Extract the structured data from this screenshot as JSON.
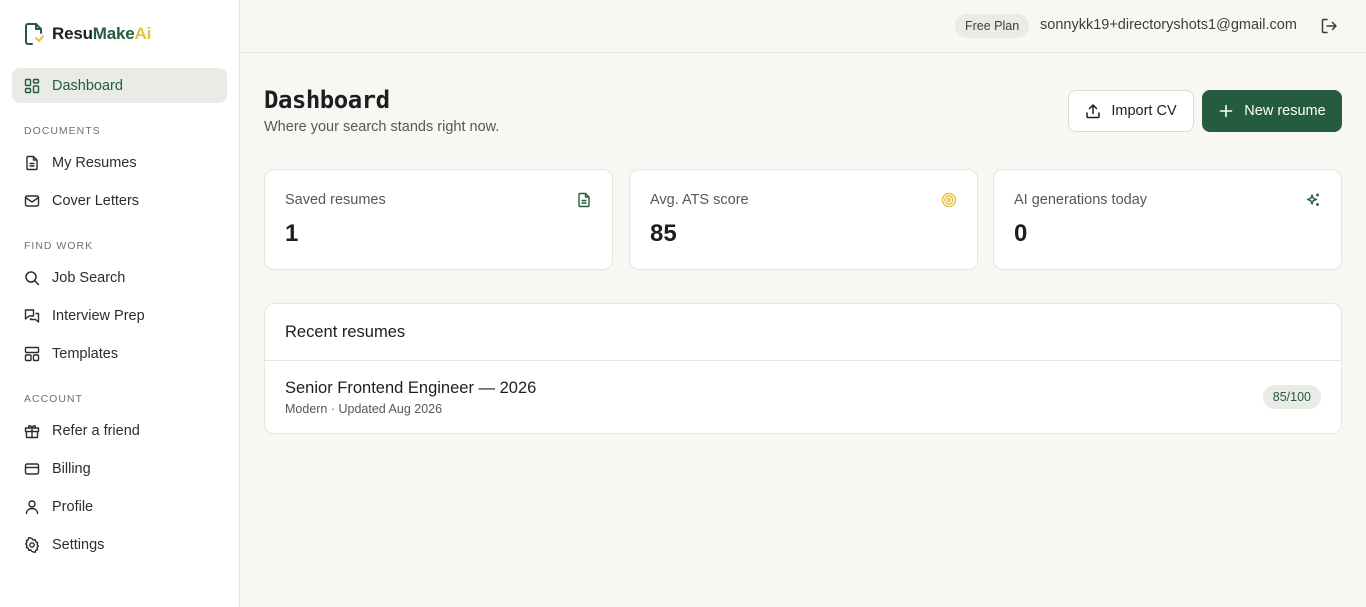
{
  "brand": {
    "part1": "Resu",
    "part2": "Make",
    "part3": "Ai"
  },
  "sidebar": {
    "dashboard": "Dashboard",
    "sections": {
      "documents": "DOCUMENTS",
      "find_work": "FIND WORK",
      "account": "ACCOUNT"
    },
    "items": {
      "my_resumes": "My Resumes",
      "cover_letters": "Cover Letters",
      "job_search": "Job Search",
      "interview_prep": "Interview Prep",
      "templates": "Templates",
      "refer": "Refer a friend",
      "billing": "Billing",
      "profile": "Profile",
      "settings": "Settings"
    }
  },
  "header": {
    "plan": "Free Plan",
    "email": "sonnykk19+directoryshots1@gmail.com"
  },
  "main": {
    "title": "Dashboard",
    "subtitle": "Where your search stands right now.",
    "import_label": "Import CV",
    "new_label": "New resume",
    "stats": [
      {
        "label": "Saved resumes",
        "value": "1",
        "icon": "document-icon"
      },
      {
        "label": "Avg. ATS score",
        "value": "85",
        "icon": "target-icon"
      },
      {
        "label": "AI generations today",
        "value": "0",
        "icon": "sparkles-icon"
      }
    ],
    "recent": {
      "title": "Recent resumes",
      "items": [
        {
          "title": "Senior Frontend Engineer — 2026",
          "meta": "Modern · Updated Aug 2026",
          "score": "85/100"
        }
      ]
    }
  },
  "colors": {
    "accent": "#255c3f",
    "brand_yellow": "#e7c33b",
    "background": "#f8f7f4"
  }
}
